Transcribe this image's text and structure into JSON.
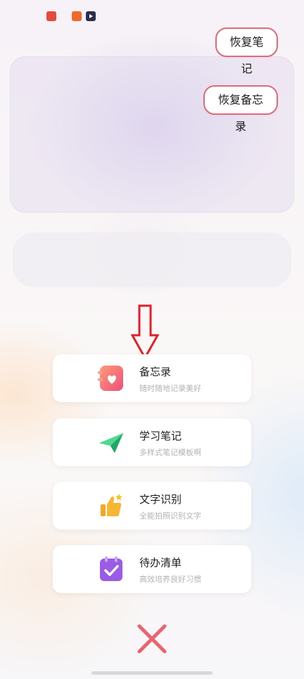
{
  "restore": {
    "notes_label": "恢复笔记",
    "memo_label": "恢复备忘录"
  },
  "menu": [
    {
      "title": "备忘录",
      "subtitle": "随时随地记录美好",
      "icon": "memo-heart-icon",
      "color": "#f0607a"
    },
    {
      "title": "学习笔记",
      "subtitle": "多样式笔记模板啊",
      "icon": "paper-plane-icon",
      "color": "#2bc47a"
    },
    {
      "title": "文字识别",
      "subtitle": "全能拍照识别文字",
      "icon": "thumbs-up-icon",
      "color": "#f5b630"
    },
    {
      "title": "待办清单",
      "subtitle": "高效培养良好习惯",
      "icon": "calendar-check-icon",
      "color": "#9a5ce6"
    }
  ],
  "colors": {
    "accent_red": "#e06a7a",
    "close_red": "#e8646f"
  }
}
